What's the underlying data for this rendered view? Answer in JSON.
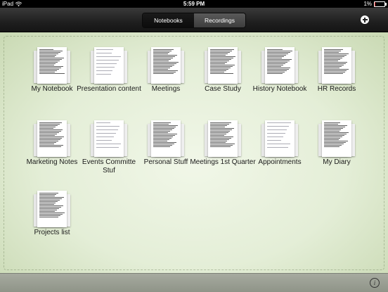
{
  "status_bar": {
    "carrier": "iPad",
    "time": "5:59 PM",
    "battery_text": "1%",
    "battery_level": 0.01
  },
  "toolbar": {
    "tabs": [
      {
        "label": "Notebooks",
        "active": true
      },
      {
        "label": "Recordings",
        "active": false
      }
    ],
    "add_icon": "plus-circle-icon"
  },
  "notebooks": [
    {
      "name": "My Notebook",
      "style": "typed"
    },
    {
      "name": "Presentation content",
      "style": "handwritten"
    },
    {
      "name": "Meetings",
      "style": "typed"
    },
    {
      "name": "Case Study",
      "style": "typed"
    },
    {
      "name": "History Notebook",
      "style": "typed"
    },
    {
      "name": "HR Records",
      "style": "typed"
    },
    {
      "name": "Marketing Notes",
      "style": "typed"
    },
    {
      "name": "Events Committe Stuf",
      "style": "handwritten"
    },
    {
      "name": "Personal Stuff",
      "style": "typed"
    },
    {
      "name": "Meetings 1st Quarter",
      "style": "typed"
    },
    {
      "name": "Appointments",
      "style": "handwritten"
    },
    {
      "name": "My Diary",
      "style": "typed"
    },
    {
      "name": "Projects list",
      "style": "typed"
    }
  ],
  "bottom_bar": {
    "info_icon": "info-icon",
    "info_glyph": "i"
  }
}
